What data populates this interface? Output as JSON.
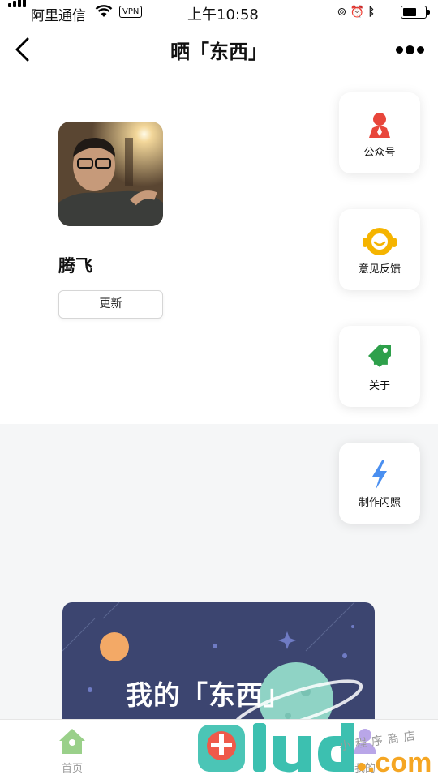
{
  "status_bar": {
    "carrier": "阿里通信",
    "vpn": "VPN",
    "time": "上午10:58",
    "battery_level": 0.65
  },
  "nav": {
    "title": "晒「东西」",
    "back_icon": "chevron-left-icon",
    "more_icon": "more-dots-icon"
  },
  "profile": {
    "name": "腾飞",
    "update_label": "更新"
  },
  "cards": [
    {
      "label": "公众号",
      "icon": "official-account-icon",
      "color": "#e8463b"
    },
    {
      "label": "意见反馈",
      "icon": "feedback-headset-icon",
      "color": "#f5b400"
    },
    {
      "label": "关于",
      "icon": "tag-icon",
      "color": "#2ea04b"
    },
    {
      "label": "制作闪照",
      "icon": "lightning-icon",
      "color": "#4a8ff0"
    }
  ],
  "banner": {
    "title": "我的「东西」"
  },
  "tabbar": {
    "tabs": [
      {
        "label": "首页",
        "icon": "home-icon"
      },
      {
        "label": "我的",
        "icon": "user-icon"
      }
    ]
  },
  "watermark": {
    "brand": "9lud",
    "suffix": ".com",
    "tagline": "小程序商店"
  },
  "colors": {
    "banner_bg": "#3c4570",
    "tab_active": "#9ad08a",
    "page_bg_lower": "#f5f6f7"
  }
}
